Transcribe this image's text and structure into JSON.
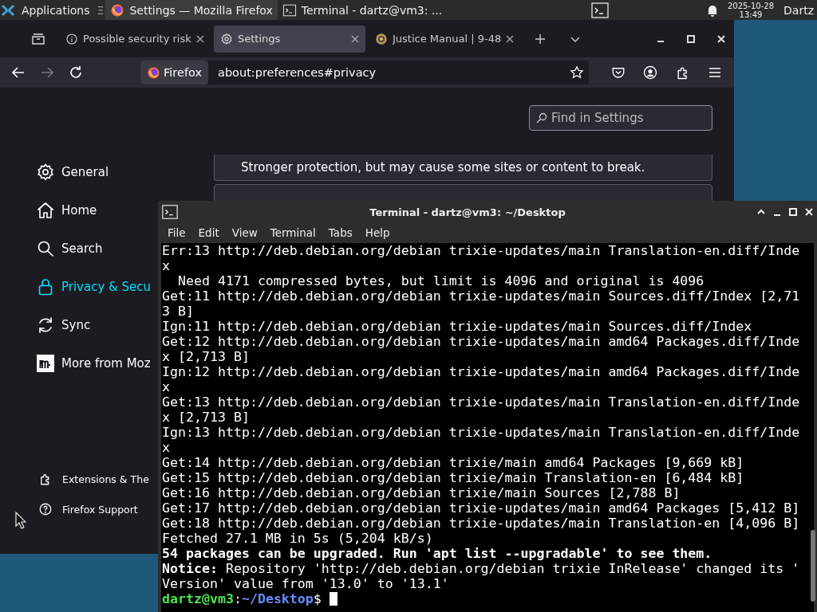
{
  "panel": {
    "apps_label": "Applications",
    "apps_suffix": "Ξ",
    "tasks": [
      {
        "title": "Settings — Mozilla Firefox",
        "kind": "firefox",
        "selected": true
      },
      {
        "title": "Terminal - dartz@vm3: ...",
        "kind": "terminal",
        "selected": false
      }
    ],
    "date": "2025-10-28",
    "time": "13:49",
    "user": "Dartz"
  },
  "firefox": {
    "tabs": [
      {
        "title": "Possible security risk",
        "kind": "info",
        "selected": false
      },
      {
        "title": "Settings",
        "kind": "gear",
        "selected": true
      },
      {
        "title": "Justice Manual | 9-48",
        "kind": "seal",
        "selected": false
      }
    ],
    "identity": "Firefox",
    "url": "about:preferences#privacy",
    "search": {
      "placeholder": "Find in Settings"
    },
    "nav": [
      {
        "label": "General",
        "kind": "gear",
        "selected": false
      },
      {
        "label": "Home",
        "kind": "home",
        "selected": false
      },
      {
        "label": "Search",
        "kind": "search",
        "selected": false
      },
      {
        "label": "Privacy & Secu",
        "kind": "lock",
        "selected": true
      },
      {
        "label": "Sync",
        "kind": "sync",
        "selected": false
      },
      {
        "label": "More from Moz",
        "kind": "mozilla",
        "selected": false
      }
    ],
    "footer": [
      {
        "label": "Extensions & The",
        "kind": "puzzle"
      },
      {
        "label": "Firefox Support",
        "kind": "help"
      }
    ],
    "card_text": "Stronger protection, but may cause some sites or content to break."
  },
  "terminal": {
    "title": "Terminal - dartz@vm3: ~/Desktop",
    "menu": [
      "File",
      "Edit",
      "View",
      "Terminal",
      "Tabs",
      "Help"
    ],
    "lines": [
      {
        "kind": "plain",
        "text": "Err:13 http://deb.debian.org/debian trixie-updates/main Translation-en.diff/Inde"
      },
      {
        "kind": "plain",
        "text": "x"
      },
      {
        "kind": "plain",
        "text": "  Need 4171 compressed bytes, but limit is 4096 and original is 4096"
      },
      {
        "kind": "plain",
        "text": "Get:11 http://deb.debian.org/debian trixie-updates/main Sources.diff/Index [2,71"
      },
      {
        "kind": "plain",
        "text": "3 B]"
      },
      {
        "kind": "plain",
        "text": "Ign:11 http://deb.debian.org/debian trixie-updates/main Sources.diff/Index"
      },
      {
        "kind": "plain",
        "text": "Get:12 http://deb.debian.org/debian trixie-updates/main amd64 Packages.diff/Inde"
      },
      {
        "kind": "plain",
        "text": "x [2,713 B]"
      },
      {
        "kind": "plain",
        "text": "Ign:12 http://deb.debian.org/debian trixie-updates/main amd64 Packages.diff/Inde"
      },
      {
        "kind": "plain",
        "text": "x"
      },
      {
        "kind": "plain",
        "text": "Get:13 http://deb.debian.org/debian trixie-updates/main Translation-en.diff/Inde"
      },
      {
        "kind": "plain",
        "text": "x [2,713 B]"
      },
      {
        "kind": "plain",
        "text": "Ign:13 http://deb.debian.org/debian trixie-updates/main Translation-en.diff/Inde"
      },
      {
        "kind": "plain",
        "text": "x"
      },
      {
        "kind": "plain",
        "text": "Get:14 http://deb.debian.org/debian trixie/main amd64 Packages [9,669 kB]"
      },
      {
        "kind": "plain",
        "text": "Get:15 http://deb.debian.org/debian trixie/main Translation-en [6,484 kB]"
      },
      {
        "kind": "plain",
        "text": "Get:16 http://deb.debian.org/debian trixie/main Sources [2,788 B]"
      },
      {
        "kind": "plain",
        "text": "Get:17 http://deb.debian.org/debian trixie-updates/main amd64 Packages [5,412 B]"
      },
      {
        "kind": "plain",
        "text": "Get:18 http://deb.debian.org/debian trixie-updates/main Translation-en [4,096 B]"
      },
      {
        "kind": "plain",
        "text": "Fetched 27.1 MB in 5s (5,204 kB/s)"
      },
      {
        "kind": "bold",
        "text": "54 packages can be upgraded. Run 'apt list --upgradable' to see them."
      },
      {
        "kind": "rich",
        "text": "**Notice:** Repository 'http://deb.debian.org/debian trixie InRelease' changed its '"
      },
      {
        "kind": "plain",
        "text": "Version' value from '13.0' to '13.1'"
      },
      {
        "kind": "prompt",
        "user": "dartz@vm3",
        "sep": ":",
        "path": "~/Desktop",
        "symbol": "$"
      }
    ]
  }
}
